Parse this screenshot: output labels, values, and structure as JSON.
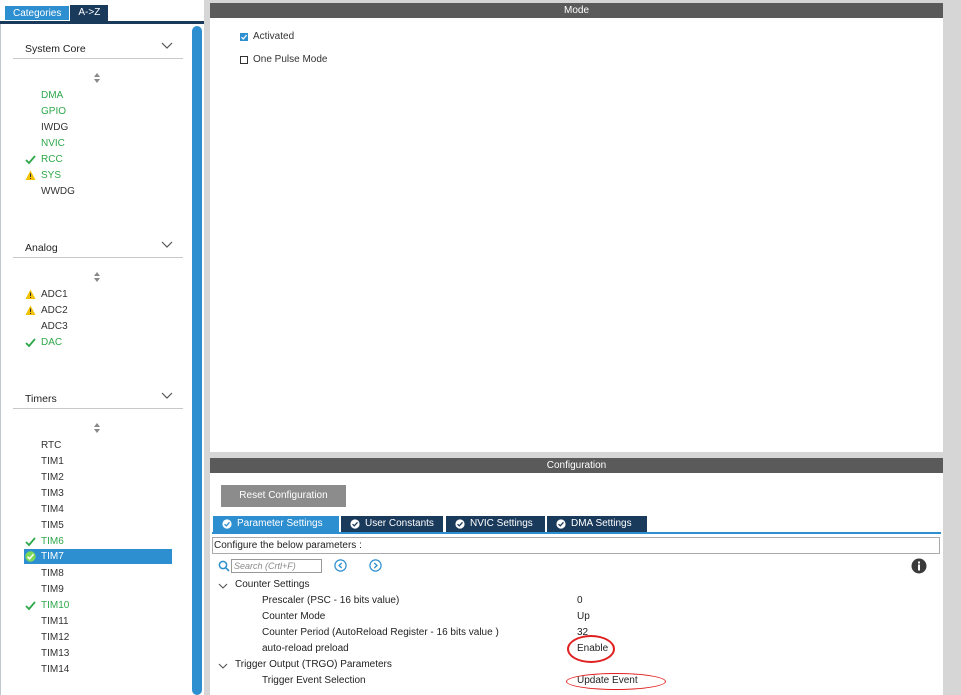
{
  "sidebar": {
    "tabs": [
      "Categories",
      "A->Z"
    ],
    "categories": [
      {
        "label": "System Core",
        "items": [
          {
            "label": "DMA",
            "status": "enabled"
          },
          {
            "label": "GPIO",
            "status": "enabled"
          },
          {
            "label": "IWDG",
            "status": "none"
          },
          {
            "label": "NVIC",
            "status": "enabled"
          },
          {
            "label": "RCC",
            "status": "check"
          },
          {
            "label": "SYS",
            "status": "warning"
          },
          {
            "label": "WWDG",
            "status": "none"
          }
        ]
      },
      {
        "label": "Analog",
        "items": [
          {
            "label": "ADC1",
            "status": "warning"
          },
          {
            "label": "ADC2",
            "status": "warning"
          },
          {
            "label": "ADC3",
            "status": "none"
          },
          {
            "label": "DAC",
            "status": "check"
          }
        ]
      },
      {
        "label": "Timers",
        "items": [
          {
            "label": "RTC",
            "status": "none"
          },
          {
            "label": "TIM1",
            "status": "none"
          },
          {
            "label": "TIM2",
            "status": "none"
          },
          {
            "label": "TIM3",
            "status": "none"
          },
          {
            "label": "TIM4",
            "status": "none"
          },
          {
            "label": "TIM5",
            "status": "none"
          },
          {
            "label": "TIM6",
            "status": "check"
          },
          {
            "label": "TIM7",
            "status": "selected"
          },
          {
            "label": "TIM8",
            "status": "none"
          },
          {
            "label": "TIM9",
            "status": "none"
          },
          {
            "label": "TIM10",
            "status": "check"
          },
          {
            "label": "TIM11",
            "status": "none"
          },
          {
            "label": "TIM12",
            "status": "none"
          },
          {
            "label": "TIM13",
            "status": "none"
          },
          {
            "label": "TIM14",
            "status": "none"
          }
        ]
      }
    ]
  },
  "mode": {
    "title": "Mode",
    "options": [
      {
        "label": "Activated",
        "checked": true
      },
      {
        "label": "One Pulse Mode",
        "checked": false
      }
    ]
  },
  "configuration": {
    "title": "Configuration",
    "reset_label": "Reset Configuration",
    "tabs": [
      "Parameter Settings",
      "User Constants",
      "NVIC Settings",
      "DMA Settings"
    ],
    "description": "Configure the below parameters :",
    "search_placeholder": "Search (Crtl+F)",
    "groups": [
      {
        "label": "Counter Settings",
        "params": [
          {
            "name": "Prescaler (PSC - 16 bits value)",
            "value": "0"
          },
          {
            "name": "Counter Mode",
            "value": "Up"
          },
          {
            "name": "Counter Period (AutoReload Register - 16 bits value )",
            "value": "32"
          },
          {
            "name": "auto-reload preload",
            "value": "Enable"
          }
        ]
      },
      {
        "label": "Trigger Output (TRGO) Parameters",
        "params": [
          {
            "name": "Trigger Event Selection",
            "value": "Update Event"
          }
        ]
      }
    ]
  },
  "colors": {
    "accent": "#2e8fd0",
    "dark_navy": "#1a3a5c",
    "enabled_green": "#2ea84a",
    "warning_yellow": "#f2c200",
    "highlight_red": "#e02020"
  }
}
